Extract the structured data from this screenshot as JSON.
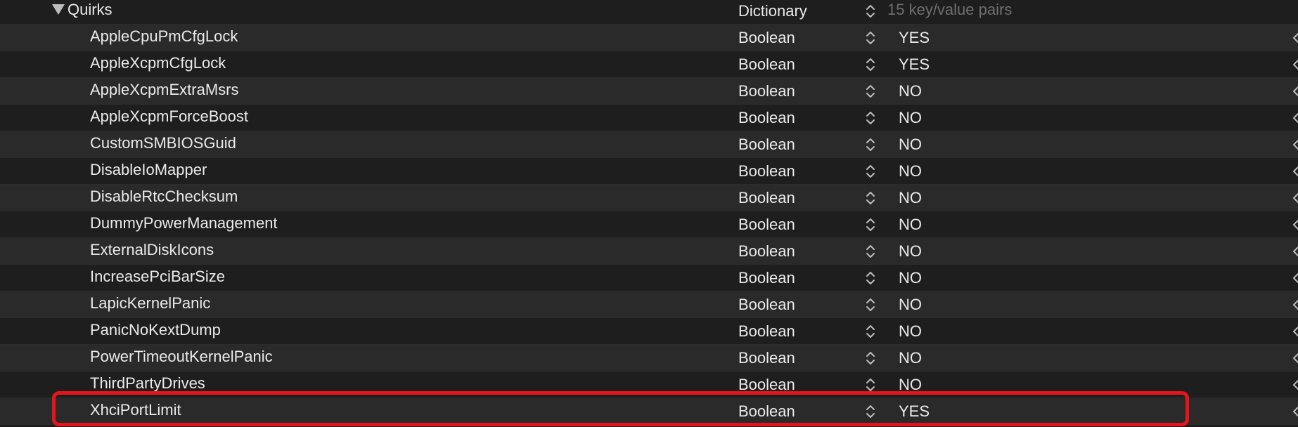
{
  "quirks": {
    "key": "Quirks",
    "type": "Dictionary",
    "summary": "15 key/value pairs"
  },
  "rows": [
    {
      "key": "AppleCpuPmCfgLock",
      "type": "Boolean",
      "value": "YES"
    },
    {
      "key": "AppleXcpmCfgLock",
      "type": "Boolean",
      "value": "YES"
    },
    {
      "key": "AppleXcpmExtraMsrs",
      "type": "Boolean",
      "value": "NO"
    },
    {
      "key": "AppleXcpmForceBoost",
      "type": "Boolean",
      "value": "NO"
    },
    {
      "key": "CustomSMBIOSGuid",
      "type": "Boolean",
      "value": "NO"
    },
    {
      "key": "DisableIoMapper",
      "type": "Boolean",
      "value": "NO"
    },
    {
      "key": "DisableRtcChecksum",
      "type": "Boolean",
      "value": "NO"
    },
    {
      "key": "DummyPowerManagement",
      "type": "Boolean",
      "value": "NO"
    },
    {
      "key": "ExternalDiskIcons",
      "type": "Boolean",
      "value": "NO"
    },
    {
      "key": "IncreasePciBarSize",
      "type": "Boolean",
      "value": "NO"
    },
    {
      "key": "LapicKernelPanic",
      "type": "Boolean",
      "value": "NO"
    },
    {
      "key": "PanicNoKextDump",
      "type": "Boolean",
      "value": "NO"
    },
    {
      "key": "PowerTimeoutKernelPanic",
      "type": "Boolean",
      "value": "NO"
    },
    {
      "key": "ThirdPartyDrives",
      "type": "Boolean",
      "value": "NO"
    },
    {
      "key": "XhciPortLimit",
      "type": "Boolean",
      "value": "YES"
    }
  ],
  "icons": {
    "disclosure": "disclosure-triangle-down-icon",
    "stepper": "up-down-chevron-icon",
    "edge": "chevron-left-icon"
  },
  "colors": {
    "highlight": "#e8141c",
    "row_odd": "#2a2a2b",
    "row_even": "#1e1e1e",
    "dim_text": "#6f6f6f"
  }
}
